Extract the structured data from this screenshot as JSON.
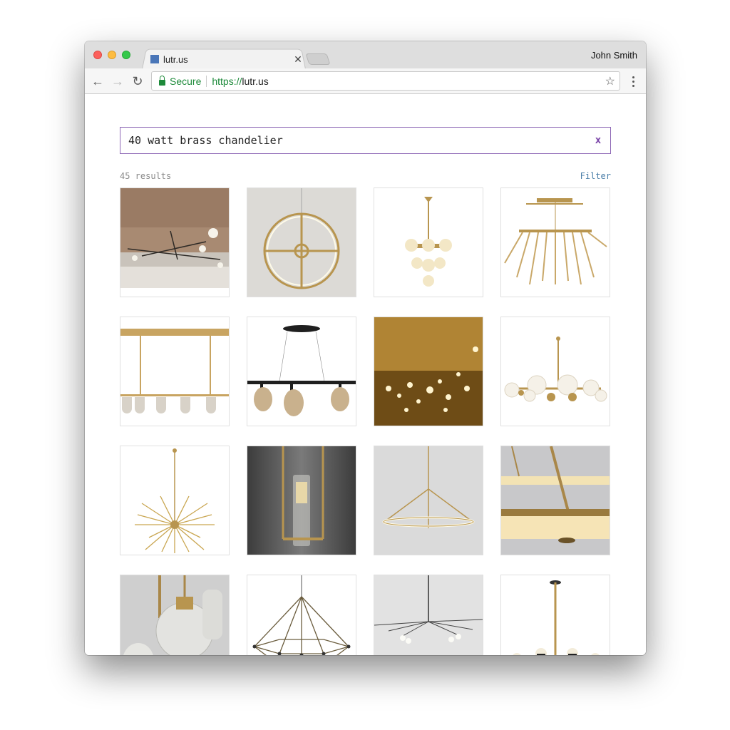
{
  "browser": {
    "tab_title": "lutr.us",
    "profile_name": "John Smith",
    "secure_label": "Secure",
    "url_scheme": "https://",
    "url_host": "lutr.us",
    "icons": {
      "back": "arrow-left-icon",
      "forward": "arrow-right-icon",
      "reload": "reload-icon",
      "bookmark": "star-icon",
      "menu": "more-vert-icon"
    }
  },
  "search": {
    "query": "40 watt brass chandelier",
    "clear_label": "x"
  },
  "results": {
    "count_text": "45 results",
    "filter_label": "Filter"
  },
  "products": [
    {
      "name": "product-1"
    },
    {
      "name": "product-2"
    },
    {
      "name": "product-3"
    },
    {
      "name": "product-4"
    },
    {
      "name": "product-5"
    },
    {
      "name": "product-6"
    },
    {
      "name": "product-7"
    },
    {
      "name": "product-8"
    },
    {
      "name": "product-9"
    },
    {
      "name": "product-10"
    },
    {
      "name": "product-11"
    },
    {
      "name": "product-12"
    },
    {
      "name": "product-13"
    },
    {
      "name": "product-14"
    },
    {
      "name": "product-15"
    },
    {
      "name": "product-16"
    }
  ],
  "colors": {
    "accent": "#8e68b6",
    "link": "#4a7ea8",
    "secure": "#1d8a3a",
    "brass": "#b8954f"
  }
}
